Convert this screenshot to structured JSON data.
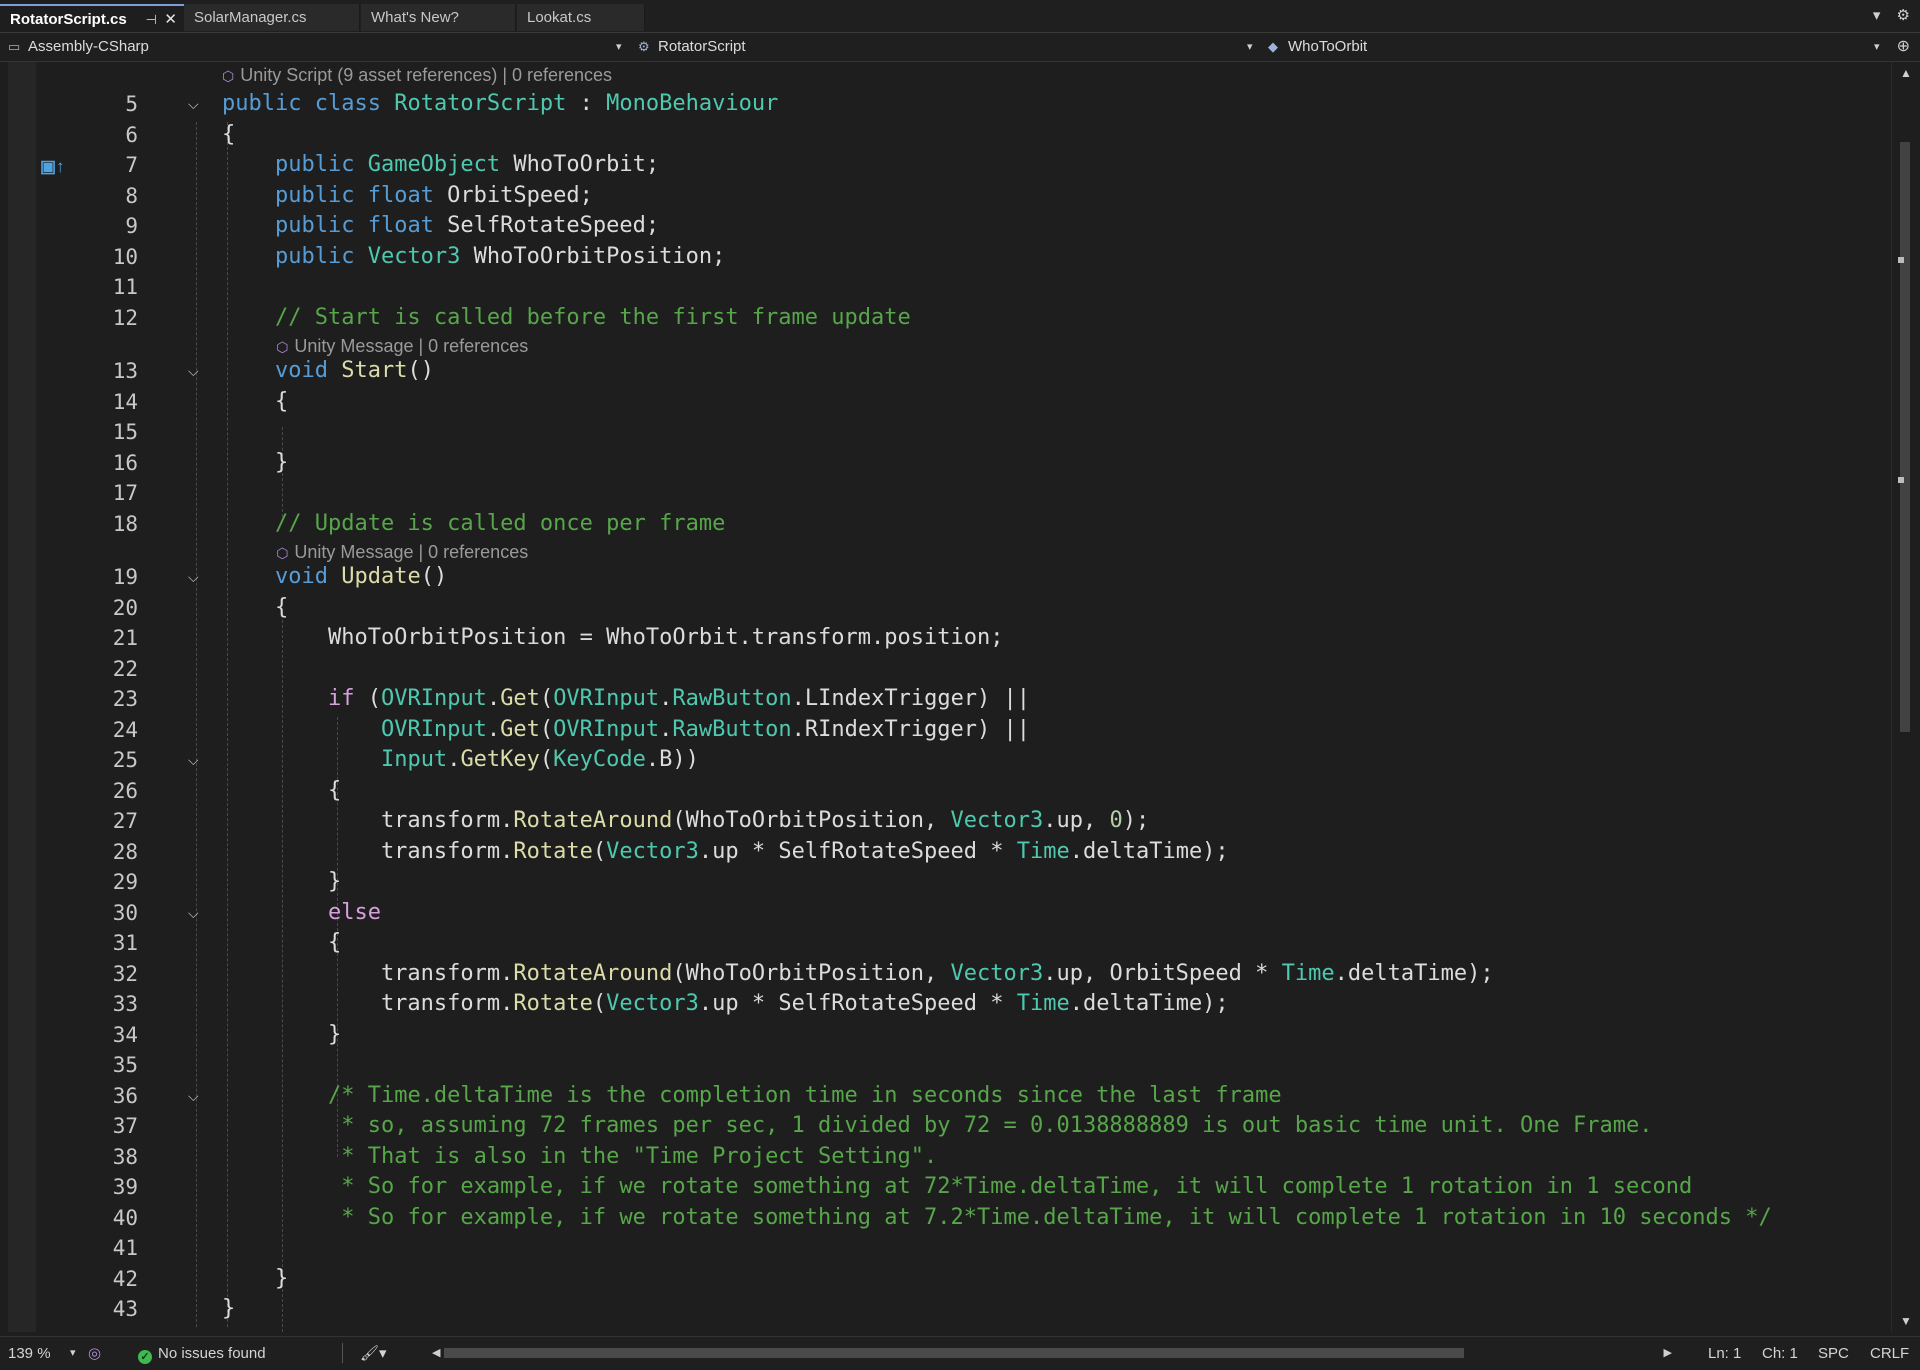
{
  "tabs": [
    {
      "label": "RotatorScript.cs",
      "active": true
    },
    {
      "label": "SolarManager.cs",
      "active": false
    },
    {
      "label": "What's New?",
      "active": false
    },
    {
      "label": "Lookat.cs",
      "active": false
    }
  ],
  "navbar": {
    "project": "Assembly-CSharp",
    "class": "RotatorScript",
    "member": "WhoToOrbit"
  },
  "lens": {
    "class_refs": "Unity Script (9 asset references) | 0 references",
    "start_refs": "Unity Message | 0 references",
    "update_refs": "Unity Message | 0 references"
  },
  "code_lines": [
    {
      "n": "5",
      "fold": true,
      "lens_before": "class_refs",
      "tokens": [
        [
          "kw",
          "public "
        ],
        [
          "kw",
          "class "
        ],
        [
          "ty",
          "RotatorScript"
        ],
        [
          "pl",
          " : "
        ],
        [
          "ty",
          "MonoBehaviour"
        ]
      ]
    },
    {
      "n": "6",
      "fold": false,
      "tokens": [
        [
          "pl",
          "{"
        ]
      ]
    },
    {
      "n": "7",
      "fold": false,
      "tokens": [
        [
          "pl",
          "    "
        ],
        [
          "kw",
          "public "
        ],
        [
          "ty",
          "GameObject"
        ],
        [
          "pl",
          " WhoToOrbit;"
        ]
      ]
    },
    {
      "n": "8",
      "fold": false,
      "tokens": [
        [
          "pl",
          "    "
        ],
        [
          "kw",
          "public "
        ],
        [
          "kw",
          "float"
        ],
        [
          "pl",
          " OrbitSpeed;"
        ]
      ]
    },
    {
      "n": "9",
      "fold": false,
      "tokens": [
        [
          "pl",
          "    "
        ],
        [
          "kw",
          "public "
        ],
        [
          "kw",
          "float"
        ],
        [
          "pl",
          " SelfRotateSpeed;"
        ]
      ]
    },
    {
      "n": "10",
      "fold": false,
      "tokens": [
        [
          "pl",
          "    "
        ],
        [
          "kw",
          "public "
        ],
        [
          "ty",
          "Vector3"
        ],
        [
          "pl",
          " WhoToOrbitPosition;"
        ]
      ]
    },
    {
      "n": "11",
      "fold": false,
      "tokens": []
    },
    {
      "n": "12",
      "fold": false,
      "tokens": [
        [
          "pl",
          "    "
        ],
        [
          "cm",
          "// Start is called before the first frame update"
        ]
      ]
    },
    {
      "n": "13",
      "fold": true,
      "lens_before": "start_refs",
      "tokens": [
        [
          "pl",
          "    "
        ],
        [
          "kw",
          "void "
        ],
        [
          "fn",
          "Start"
        ],
        [
          "pl",
          "()"
        ]
      ]
    },
    {
      "n": "14",
      "fold": false,
      "tokens": [
        [
          "pl",
          "    {"
        ]
      ]
    },
    {
      "n": "15",
      "fold": false,
      "tokens": []
    },
    {
      "n": "16",
      "fold": false,
      "tokens": [
        [
          "pl",
          "    }"
        ]
      ]
    },
    {
      "n": "17",
      "fold": false,
      "tokens": []
    },
    {
      "n": "18",
      "fold": false,
      "tokens": [
        [
          "pl",
          "    "
        ],
        [
          "cm",
          "// Update is called once per frame"
        ]
      ]
    },
    {
      "n": "19",
      "fold": true,
      "lens_before": "update_refs",
      "tokens": [
        [
          "pl",
          "    "
        ],
        [
          "kw",
          "void "
        ],
        [
          "fn",
          "Update"
        ],
        [
          "pl",
          "()"
        ]
      ]
    },
    {
      "n": "20",
      "fold": false,
      "tokens": [
        [
          "pl",
          "    {"
        ]
      ]
    },
    {
      "n": "21",
      "fold": false,
      "tokens": [
        [
          "pl",
          "        WhoToOrbitPosition = WhoToOrbit.transform.position;"
        ]
      ]
    },
    {
      "n": "22",
      "fold": false,
      "tokens": []
    },
    {
      "n": "23",
      "fold": false,
      "tokens": [
        [
          "pl",
          "        "
        ],
        [
          "kw2",
          "if"
        ],
        [
          "pl",
          " ("
        ],
        [
          "ty",
          "OVRInput"
        ],
        [
          "pl",
          "."
        ],
        [
          "fn",
          "Get"
        ],
        [
          "pl",
          "("
        ],
        [
          "ty",
          "OVRInput"
        ],
        [
          "pl",
          "."
        ],
        [
          "ty",
          "RawButton"
        ],
        [
          "pl",
          ".LIndexTrigger) ||"
        ]
      ]
    },
    {
      "n": "24",
      "fold": false,
      "tokens": [
        [
          "pl",
          "            "
        ],
        [
          "ty",
          "OVRInput"
        ],
        [
          "pl",
          "."
        ],
        [
          "fn",
          "Get"
        ],
        [
          "pl",
          "("
        ],
        [
          "ty",
          "OVRInput"
        ],
        [
          "pl",
          "."
        ],
        [
          "ty",
          "RawButton"
        ],
        [
          "pl",
          ".RIndexTrigger) ||"
        ]
      ]
    },
    {
      "n": "25",
      "fold": true,
      "tokens": [
        [
          "pl",
          "            "
        ],
        [
          "ty",
          "Input"
        ],
        [
          "pl",
          "."
        ],
        [
          "fn",
          "GetKey"
        ],
        [
          "pl",
          "("
        ],
        [
          "ty",
          "KeyCode"
        ],
        [
          "pl",
          ".B))"
        ]
      ]
    },
    {
      "n": "26",
      "fold": false,
      "tokens": [
        [
          "pl",
          "        {"
        ]
      ]
    },
    {
      "n": "27",
      "fold": false,
      "tokens": [
        [
          "pl",
          "            transform."
        ],
        [
          "fn",
          "RotateAround"
        ],
        [
          "pl",
          "(WhoToOrbitPosition, "
        ],
        [
          "ty",
          "Vector3"
        ],
        [
          "pl",
          ".up, "
        ],
        [
          "nu",
          "0"
        ],
        [
          "pl",
          ");"
        ]
      ]
    },
    {
      "n": "28",
      "fold": false,
      "tokens": [
        [
          "pl",
          "            transform."
        ],
        [
          "fn",
          "Rotate"
        ],
        [
          "pl",
          "("
        ],
        [
          "ty",
          "Vector3"
        ],
        [
          "pl",
          ".up * SelfRotateSpeed * "
        ],
        [
          "ty",
          "Time"
        ],
        [
          "pl",
          ".deltaTime);"
        ]
      ]
    },
    {
      "n": "29",
      "fold": false,
      "tokens": [
        [
          "pl",
          "        }"
        ]
      ]
    },
    {
      "n": "30",
      "fold": true,
      "tokens": [
        [
          "pl",
          "        "
        ],
        [
          "kw2",
          "else"
        ]
      ]
    },
    {
      "n": "31",
      "fold": false,
      "tokens": [
        [
          "pl",
          "        {"
        ]
      ]
    },
    {
      "n": "32",
      "fold": false,
      "tokens": [
        [
          "pl",
          "            transform."
        ],
        [
          "fn",
          "RotateAround"
        ],
        [
          "pl",
          "(WhoToOrbitPosition, "
        ],
        [
          "ty",
          "Vector3"
        ],
        [
          "pl",
          ".up, OrbitSpeed * "
        ],
        [
          "ty",
          "Time"
        ],
        [
          "pl",
          ".deltaTime);"
        ]
      ]
    },
    {
      "n": "33",
      "fold": false,
      "tokens": [
        [
          "pl",
          "            transform."
        ],
        [
          "fn",
          "Rotate"
        ],
        [
          "pl",
          "("
        ],
        [
          "ty",
          "Vector3"
        ],
        [
          "pl",
          ".up * SelfRotateSpeed * "
        ],
        [
          "ty",
          "Time"
        ],
        [
          "pl",
          ".deltaTime);"
        ]
      ]
    },
    {
      "n": "34",
      "fold": false,
      "tokens": [
        [
          "pl",
          "        }"
        ]
      ]
    },
    {
      "n": "35",
      "fold": false,
      "tokens": []
    },
    {
      "n": "36",
      "fold": true,
      "tokens": [
        [
          "pl",
          "        "
        ],
        [
          "cm",
          "/* Time.deltaTime is the completion time in seconds since the last frame"
        ]
      ]
    },
    {
      "n": "37",
      "fold": false,
      "tokens": [
        [
          "pl",
          "         "
        ],
        [
          "cm",
          "* so, assuming 72 frames per sec, 1 divided by 72 = 0.0138888889 is out basic time unit. One Frame."
        ]
      ]
    },
    {
      "n": "38",
      "fold": false,
      "tokens": [
        [
          "pl",
          "         "
        ],
        [
          "cm",
          "* That is also in the \"Time Project Setting\"."
        ]
      ]
    },
    {
      "n": "39",
      "fold": false,
      "tokens": [
        [
          "pl",
          "         "
        ],
        [
          "cm",
          "* So for example, if we rotate something at 72*Time.deltaTime, it will complete 1 rotation in 1 second"
        ]
      ]
    },
    {
      "n": "40",
      "fold": false,
      "tokens": [
        [
          "pl",
          "         "
        ],
        [
          "cm",
          "* So for example, if we rotate something at 7.2*Time.deltaTime, it will complete 1 rotation in 10 seconds */"
        ]
      ]
    },
    {
      "n": "41",
      "fold": false,
      "tokens": []
    },
    {
      "n": "42",
      "fold": false,
      "tokens": [
        [
          "pl",
          "    }"
        ]
      ]
    },
    {
      "n": "43",
      "fold": false,
      "tokens": [
        [
          "pl",
          "}"
        ]
      ]
    }
  ],
  "statusbar": {
    "zoom": "139 %",
    "issues": "No issues found",
    "line": "Ln: 1",
    "char": "Ch: 1",
    "whitespace": "SPC",
    "line_ending": "CRLF"
  },
  "colors": {
    "keyword": "#569cd6",
    "control": "#d8a0df",
    "type": "#4ec9b0",
    "method": "#dcdcaa",
    "comment": "#57a64a",
    "number": "#b5cea8",
    "plain": "#dcdcdc",
    "background": "#1e1e1e"
  },
  "icons": [
    "pin-icon",
    "close-icon",
    "gear-icon",
    "dropdown-icon",
    "split-editor-icon",
    "unity-cube-icon",
    "check-circle-icon",
    "brush-icon",
    "bookmark-icon",
    "fold-chevron-icon"
  ]
}
